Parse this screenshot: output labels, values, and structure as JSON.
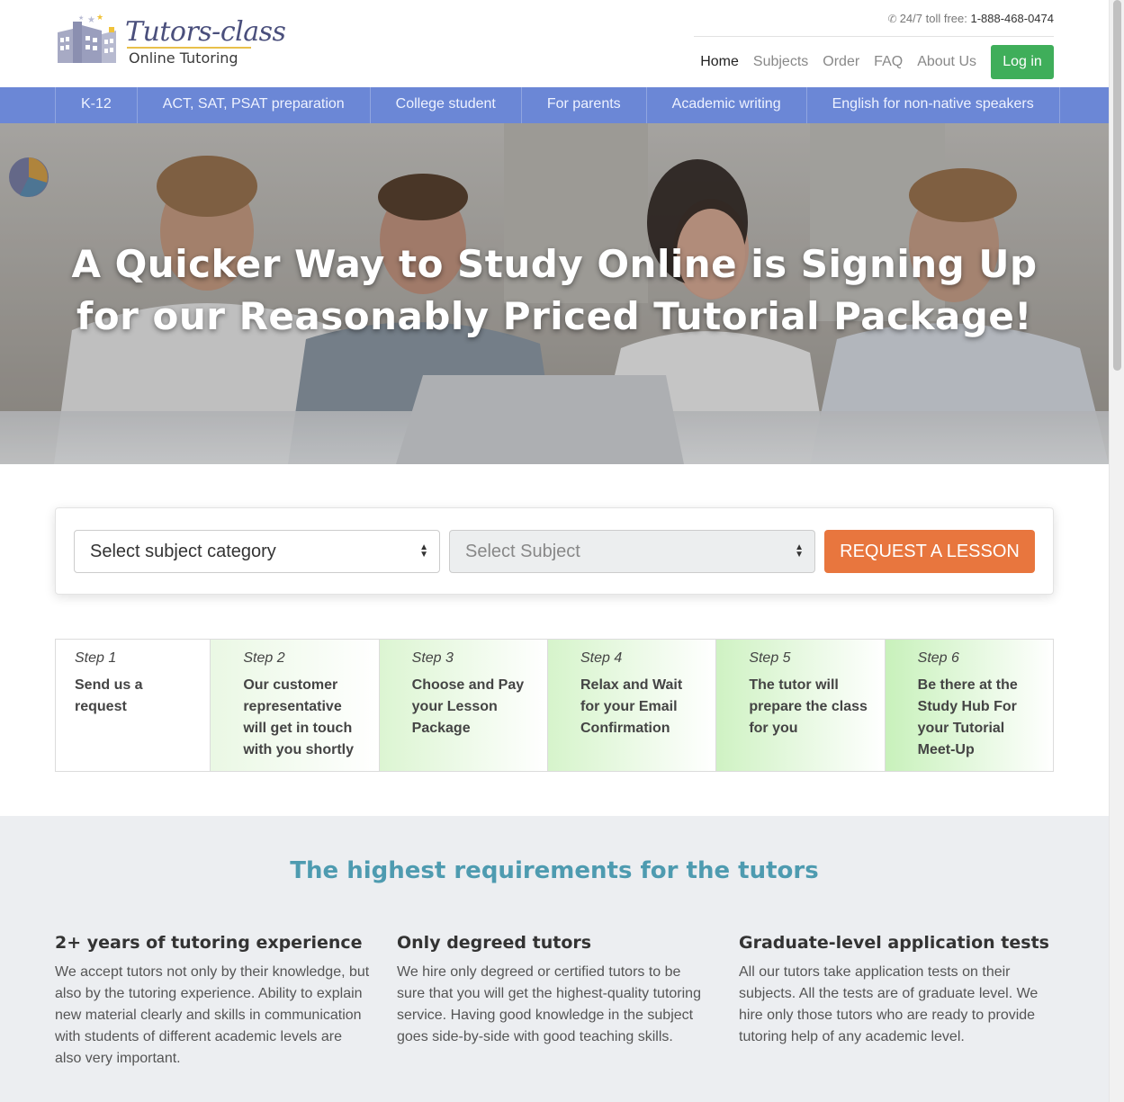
{
  "header": {
    "logo_name": "Tutors-class",
    "logo_sub": "Online Tutoring",
    "phone_label": "24/7 toll free:",
    "phone_number": "1-888-468-0474",
    "nav": [
      "Home",
      "Subjects",
      "Order",
      "FAQ",
      "About Us"
    ],
    "login": "Log in"
  },
  "subnav": [
    "K-12",
    "ACT, SAT, PSAT preparation",
    "College student",
    "For parents",
    "Academic writing",
    "English for non-native speakers"
  ],
  "hero": {
    "line1": "A Quicker Way to Study Online is Signing Up",
    "line2": "for our Reasonably Priced Tutorial Package!"
  },
  "request": {
    "category_placeholder": "Select subject category",
    "subject_placeholder": "Select Subject",
    "button": "REQUEST A LESSON"
  },
  "steps": [
    {
      "num": "Step 1",
      "text": "Send us a request"
    },
    {
      "num": "Step 2",
      "text": "Our customer representative will get in touch with you shortly"
    },
    {
      "num": "Step 3",
      "text": "Choose and Pay your Lesson Package"
    },
    {
      "num": "Step 4",
      "text": "Relax and Wait for your Email Confirmation"
    },
    {
      "num": "Step 5",
      "text": "The tutor will prepare the class for you"
    },
    {
      "num": "Step 6",
      "text": "Be there at the Study Hub For your Tutorial Meet-Up"
    }
  ],
  "requirements": {
    "title": "The highest requirements for the tutors",
    "items": [
      {
        "title": "2+ years of tutoring experience",
        "text": "We accept tutors not only by their knowledge, but also by the tutoring experience. Ability to explain new material clearly and skills in communication with students of different academic levels are also very important."
      },
      {
        "title": "Only degreed tutors",
        "text": "We hire only degreed or certified tutors to be sure that you will get the highest-quality tutoring service. Having good knowledge in the subject goes side-by-side with good teaching skills."
      },
      {
        "title": "Graduate-level application tests",
        "text": "All our tutors take application tests on their subjects. All the tests are of graduate level. We hire only those tutors who are ready to provide tutoring help of any academic level."
      }
    ]
  },
  "colors": {
    "nav_blue": "#6b87d6",
    "login_green": "#3fae5a",
    "request_orange": "#e8763e",
    "title_teal": "#4e9bb0"
  },
  "icons": {
    "phone": "phone-icon",
    "logo": "buildings-logo-icon",
    "select_arrows": "sort-arrows-icon"
  }
}
